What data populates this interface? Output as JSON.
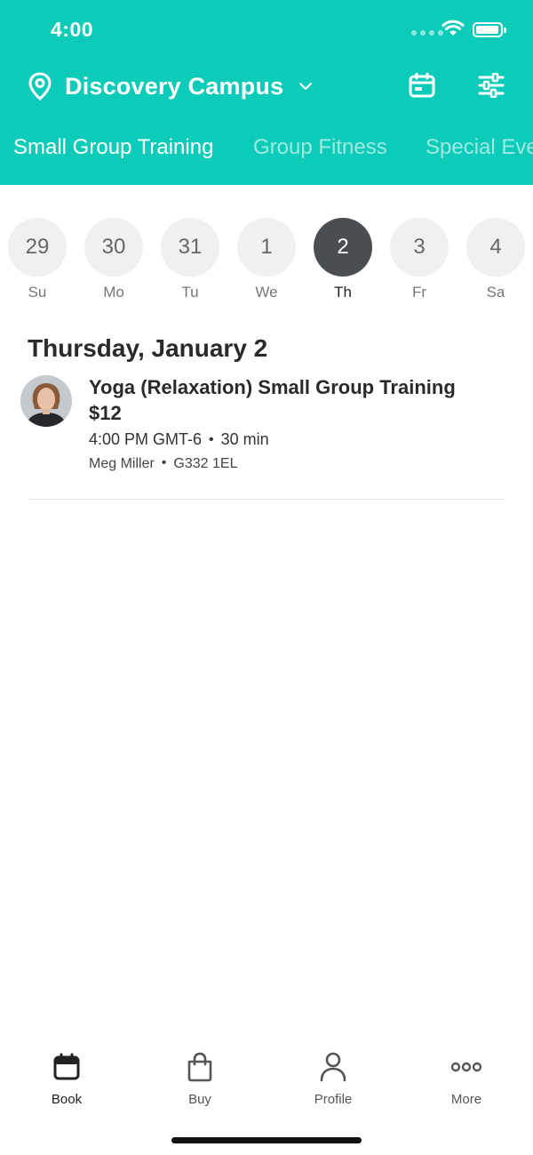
{
  "status_bar": {
    "time": "4:00"
  },
  "header": {
    "location": "Discovery Campus",
    "icons": {
      "location": "location-pin-icon",
      "dropdown": "chevron-down-icon",
      "calendar": "calendar-icon",
      "filter": "sliders-icon"
    },
    "accent_color": "#0ccbb8"
  },
  "tabs": [
    {
      "label": "Small Group Training",
      "active": true
    },
    {
      "label": "Group Fitness",
      "active": false
    },
    {
      "label": "Special Eve",
      "active": false
    }
  ],
  "days": [
    {
      "number": "29",
      "label": "Su",
      "selected": false
    },
    {
      "number": "30",
      "label": "Mo",
      "selected": false
    },
    {
      "number": "31",
      "label": "Tu",
      "selected": false
    },
    {
      "number": "1",
      "label": "We",
      "selected": false
    },
    {
      "number": "2",
      "label": "Th",
      "selected": true
    },
    {
      "number": "3",
      "label": "Fr",
      "selected": false
    },
    {
      "number": "4",
      "label": "Sa",
      "selected": false
    }
  ],
  "schedule": {
    "date_heading": "Thursday, January 2",
    "classes": [
      {
        "title": "Yoga (Relaxation) Small Group Training",
        "price": "$12",
        "time": "4:00 PM GMT-6",
        "duration": "30 min",
        "instructor": "Meg Miller",
        "room": "G332 1EL"
      }
    ]
  },
  "tab_bar": [
    {
      "label": "Book",
      "icon": "calendar-icon",
      "active": true
    },
    {
      "label": "Buy",
      "icon": "shopping-bag-icon",
      "active": false
    },
    {
      "label": "Profile",
      "icon": "person-icon",
      "active": false
    },
    {
      "label": "More",
      "icon": "more-dots-icon",
      "active": false
    }
  ]
}
